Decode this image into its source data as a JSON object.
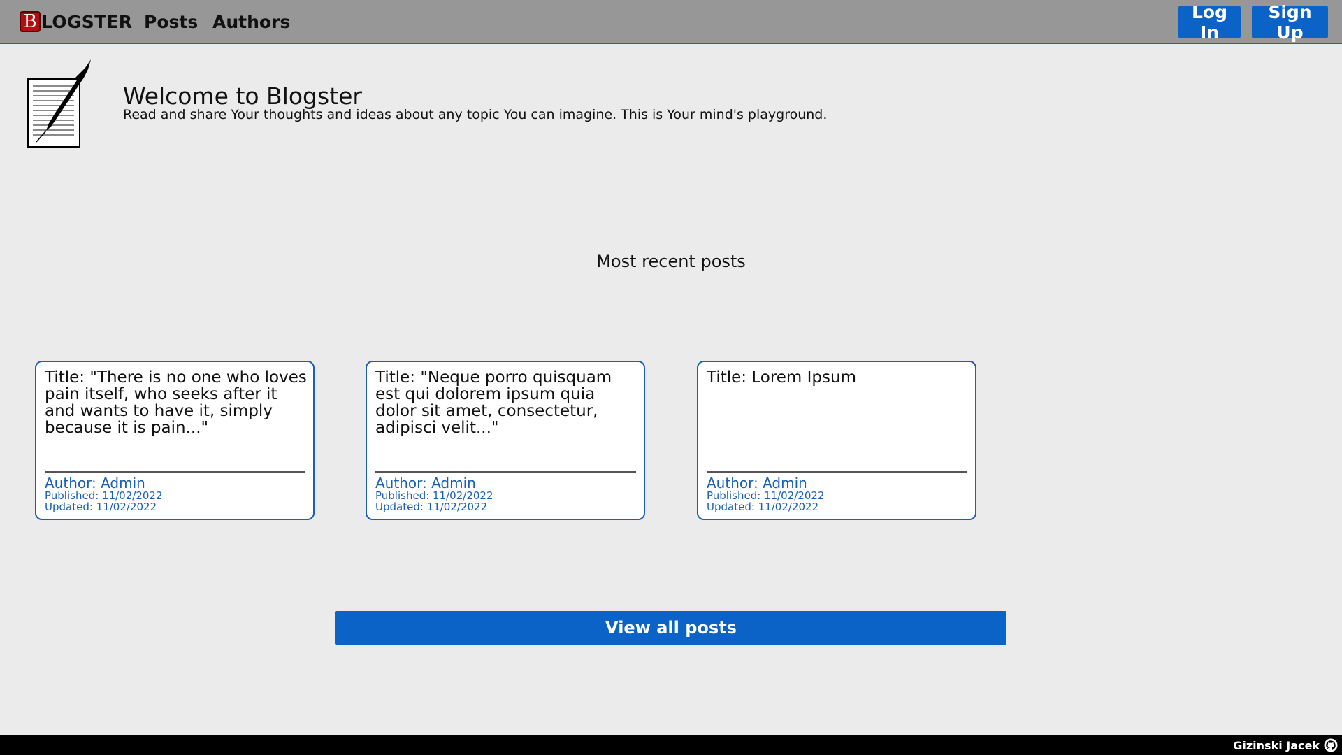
{
  "header": {
    "brand_badge": "B",
    "brand_rest": "LOGSTER",
    "nav": {
      "posts": "Posts",
      "authors": "Authors"
    },
    "login_label": "Log In",
    "signup_label": "Sign Up"
  },
  "hero": {
    "title": "Welcome to Blogster",
    "subtitle": "Read and share Your thoughts and ideas about any topic You can imagine. This is Your mind's playground.",
    "icon": "paper-pen-icon"
  },
  "recent": {
    "heading": "Most recent posts",
    "posts": [
      {
        "title": "Title: \"There is no one who loves pain itself, who seeks after it and wants to have it, simply because it is pain...\"",
        "author": "Author: Admin",
        "published": "Published: 11/02/2022",
        "updated": "Updated: 11/02/2022"
      },
      {
        "title": "Title: \"Neque porro quisquam est qui dolorem ipsum quia dolor sit amet, consectetur, adipisci velit...\"",
        "author": "Author: Admin",
        "published": "Published: 11/02/2022",
        "updated": "Updated: 11/02/2022"
      },
      {
        "title": "Title: Lorem Ipsum",
        "author": "Author: Admin",
        "published": "Published: 11/02/2022",
        "updated": "Updated: 11/02/2022"
      }
    ],
    "view_all_label": "View all posts"
  },
  "footer": {
    "author_name": "Gizinski Jacek",
    "icon": "github-icon"
  },
  "colors": {
    "header_bg": "#979797",
    "accent": "#0b63c8",
    "brand_red": "#b10f12",
    "page_bg": "#ebebeb",
    "footer_bg": "#000000"
  }
}
